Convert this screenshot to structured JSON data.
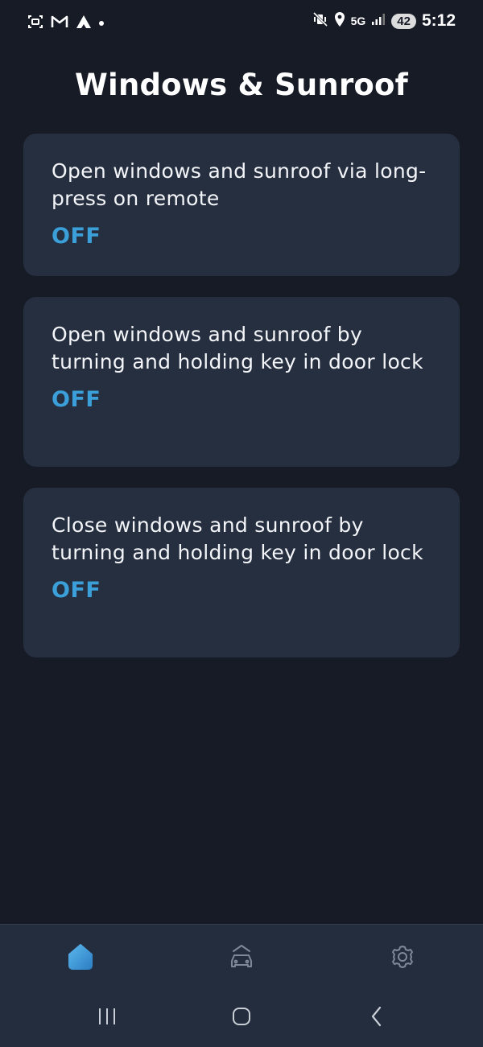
{
  "status_bar": {
    "time": "5:12",
    "network": "5G",
    "battery": "42",
    "icons_left": [
      "screenshot-icon",
      "gmail-icon",
      "app-icon",
      "dot-icon"
    ],
    "icons_right": [
      "mute-vibrate-icon",
      "location-icon",
      "signal-icon"
    ]
  },
  "page": {
    "title": "Windows & Sunroof"
  },
  "settings": [
    {
      "label": "Open windows and sunroof via long-press on remote",
      "value": "OFF"
    },
    {
      "label": "Open windows and sunroof by turning and holding key in door lock",
      "value": "OFF"
    },
    {
      "label": "Close windows and sunroof by turning and holding key in door lock",
      "value": "OFF"
    }
  ],
  "bottom_nav": {
    "items": [
      {
        "icon": "home-icon",
        "active": true
      },
      {
        "icon": "car-icon",
        "active": false
      },
      {
        "icon": "gear-icon",
        "active": false
      }
    ]
  },
  "system_nav": [
    "recents-icon",
    "home-circle-icon",
    "back-icon"
  ],
  "colors": {
    "background": "#161b26",
    "card": "#262f40",
    "accent": "#3ba0d9",
    "nav_bg": "#242d3d"
  }
}
